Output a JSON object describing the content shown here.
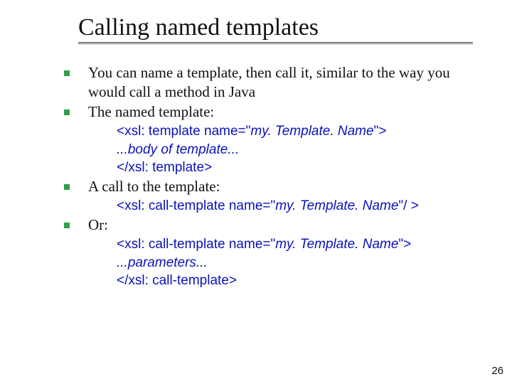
{
  "slide": {
    "title": "Calling named templates",
    "page_number": "26",
    "bullets": [
      {
        "text": "You can name a template, then call it, similar to the way you would call a method in Java"
      },
      {
        "text": "The named template:",
        "code": [
          {
            "prefix": "<xsl: template name=\"",
            "ital": "my. Template. Name",
            "suffix": "\">"
          },
          {
            "prefix": "",
            "ital": "...body of template...",
            "suffix": ""
          },
          {
            "prefix": "</xsl: template>",
            "ital": "",
            "suffix": ""
          }
        ]
      },
      {
        "text": "A call to the template:",
        "code": [
          {
            "prefix": "<xsl: call-template name=\"",
            "ital": "my. Template. Name",
            "suffix": "\"/ >"
          }
        ]
      },
      {
        "text": "Or:",
        "code": [
          {
            "prefix": "<xsl: call-template name=\"",
            "ital": "my. Template. Name",
            "suffix": "\">"
          },
          {
            "prefix": "",
            "ital": "...parameters...",
            "suffix": ""
          },
          {
            "prefix": "</xsl: call-template>",
            "ital": "",
            "suffix": ""
          }
        ]
      }
    ]
  }
}
